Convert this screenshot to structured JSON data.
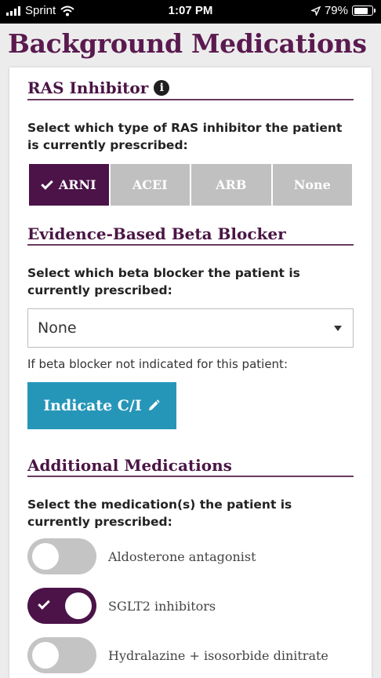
{
  "status_bar": {
    "carrier": "Sprint",
    "time": "1:07 PM",
    "battery": "79%",
    "icons": [
      "signal-icon",
      "wifi-icon",
      "location-icon",
      "battery-icon"
    ]
  },
  "page": {
    "title": "Background Medications"
  },
  "ras": {
    "title": "RAS Inhibitor",
    "prompt": "Select which type of RAS inhibitor the patient is currently prescribed:",
    "options": [
      "ARNI",
      "ACEI",
      "ARB",
      "None"
    ],
    "selected": "ARNI"
  },
  "beta": {
    "title": "Evidence-Based Beta Blocker",
    "prompt": "Select which beta blocker the patient is currently prescribed:",
    "select_value": "None",
    "helper": "If beta blocker not indicated for this patient:",
    "button_label": "Indicate C/I"
  },
  "additional": {
    "title": "Additional Medications",
    "prompt": "Select the medication(s) the patient is currently prescribed:",
    "toggles": [
      {
        "label": "Aldosterone antagonist",
        "on": false
      },
      {
        "label": "SGLT2 inhibitors",
        "on": true
      },
      {
        "label": "Hydralazine + isosorbide dinitrate",
        "on": false
      }
    ]
  },
  "colors": {
    "accent_purple": "#4b1348",
    "title_purple": "#5a1a4f",
    "button_teal": "#2696b8",
    "inactive_gray": "#c0c0c0"
  }
}
